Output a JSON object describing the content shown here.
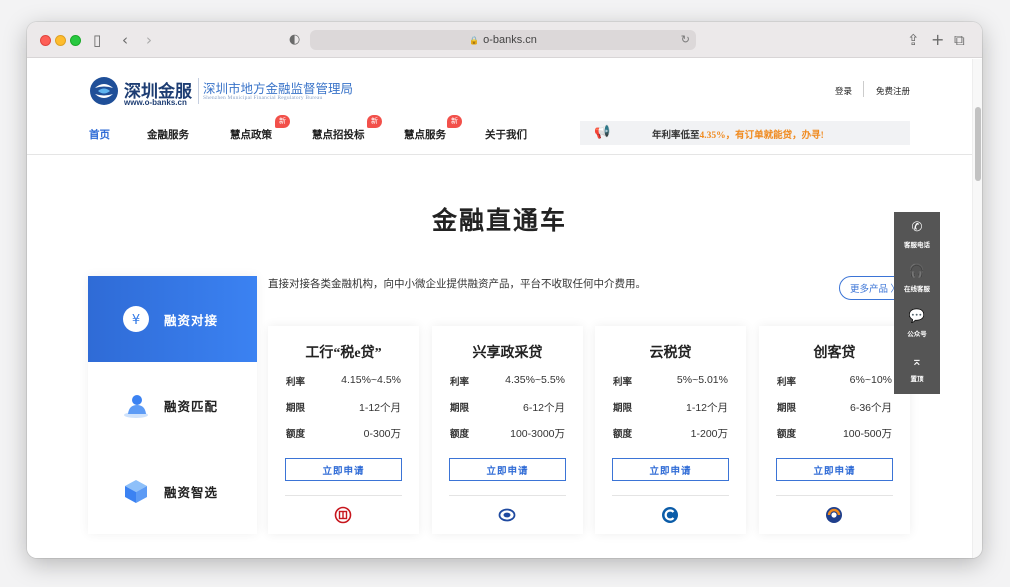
{
  "browser": {
    "url": "o-banks.cn"
  },
  "header": {
    "brand": "深圳金服",
    "brand_url": "www.o-banks.cn",
    "bureau": "深圳市地方金融监督管理局",
    "bureau_en": "Shenzhen Municipal Financial Regulatory Bureau",
    "login": "登录",
    "register": "免费注册"
  },
  "nav": {
    "items": [
      {
        "label": "首页",
        "active": true,
        "badge": ""
      },
      {
        "label": "金融服务",
        "active": false,
        "badge": ""
      },
      {
        "label": "慧点政策",
        "active": false,
        "badge": "新"
      },
      {
        "label": "慧点招投标",
        "active": false,
        "badge": "新"
      },
      {
        "label": "慧点服务",
        "active": false,
        "badge": "新"
      },
      {
        "label": "关于我们",
        "active": false,
        "badge": ""
      }
    ],
    "notice_prefix": "年利率低至",
    "notice_rate": "4.35%，有订单就能贷，办寻!"
  },
  "section": {
    "title": "金融直通车",
    "intro": "直接对接各类金融机构，向中小微企业提供融资产品，平台不收取任何中介费用。",
    "more_button": "更多产品 〉"
  },
  "tabs": [
    {
      "label": "融资对接",
      "icon": "yen-icon",
      "active": true
    },
    {
      "label": "融资匹配",
      "icon": "person-icon",
      "active": false
    },
    {
      "label": "融资智选",
      "icon": "cube-icon",
      "active": false
    }
  ],
  "cards": [
    {
      "title": "工行“税e贷”",
      "rate_label": "利率",
      "rate": "4.15%~4.5%",
      "term_label": "期限",
      "term": "1-12个月",
      "amount_label": "额度",
      "amount": "0-300万",
      "button": "立即申请",
      "bank_icon": "icbc-logo-icon",
      "bank_color": "#c7161d"
    },
    {
      "title": "兴享政采贷",
      "rate_label": "利率",
      "rate": "4.35%~5.5%",
      "term_label": "期限",
      "term": "6-12个月",
      "amount_label": "额度",
      "amount": "100-3000万",
      "button": "立即申请",
      "bank_icon": "cib-logo-icon",
      "bank_color": "#1f4aa0"
    },
    {
      "title": "云税贷",
      "rate_label": "利率",
      "rate": "5%~5.01%",
      "term_label": "期限",
      "term": "1-12个月",
      "amount_label": "额度",
      "amount": "1-200万",
      "button": "立即申请",
      "bank_icon": "ccb-logo-icon",
      "bank_color": "#0b5ca8"
    },
    {
      "title": "创客贷",
      "rate_label": "利率",
      "rate": "6%~10%",
      "term_label": "期限",
      "term": "6-36个月",
      "amount_label": "额度",
      "amount": "100-500万",
      "button": "立即申请",
      "bank_icon": "bank-logo-icon",
      "bank_color": "#1f3f8c"
    }
  ],
  "float_bar": [
    {
      "icon": "phone-icon",
      "label": "客服电话"
    },
    {
      "icon": "headset-icon",
      "label": "在线客服"
    },
    {
      "icon": "wechat-icon",
      "label": "公众号"
    },
    {
      "icon": "top-icon",
      "label": "置顶"
    }
  ]
}
